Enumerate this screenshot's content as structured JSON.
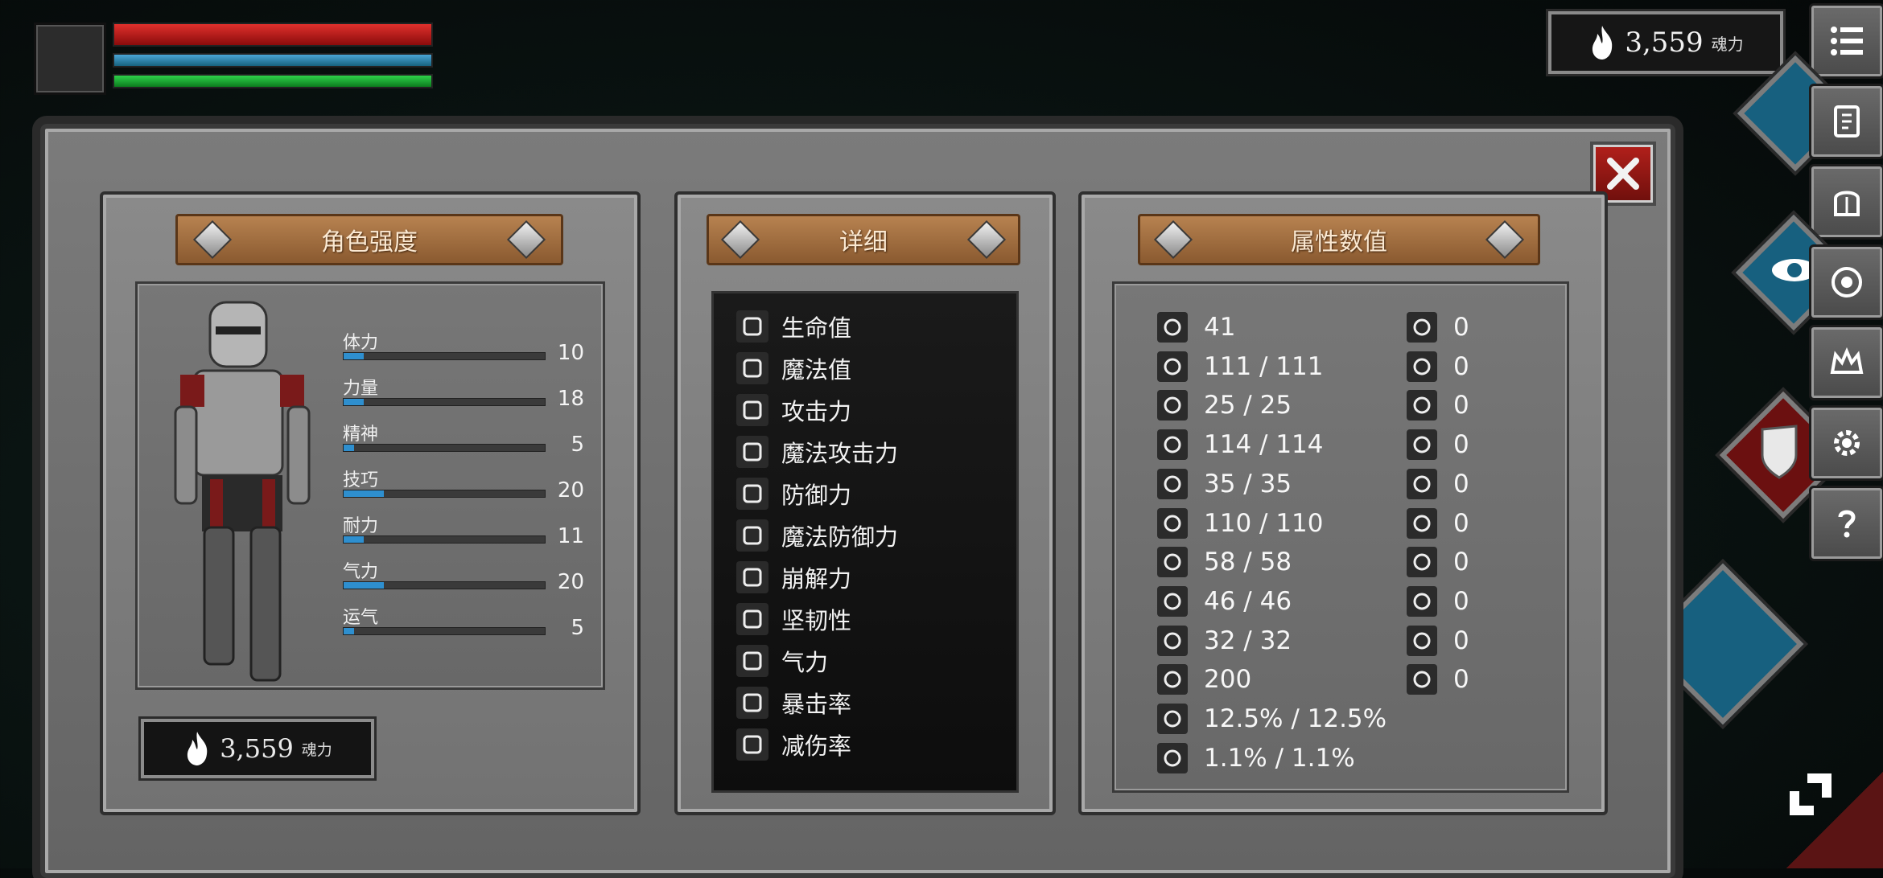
{
  "hud": {
    "hp_pct": 100,
    "mp_pct": 100,
    "stamina_pct": 100
  },
  "souls": {
    "value": "3,559",
    "unit": "魂力"
  },
  "side_menu": [
    "menu-icon",
    "journal-icon",
    "helmet-icon",
    "rune-icon",
    "crown-icon",
    "gear-icon",
    "help-icon"
  ],
  "strength_panel": {
    "title": "角色强度",
    "stats": [
      {
        "label": "体力",
        "value": "10",
        "fill": 0.1
      },
      {
        "label": "力量",
        "value": "18",
        "fill": 0.1
      },
      {
        "label": "精神",
        "value": "5",
        "fill": 0.05
      },
      {
        "label": "技巧",
        "value": "20",
        "fill": 0.2
      },
      {
        "label": "耐力",
        "value": "11",
        "fill": 0.1
      },
      {
        "label": "气力",
        "value": "20",
        "fill": 0.2
      },
      {
        "label": "运气",
        "value": "5",
        "fill": 0.05
      }
    ]
  },
  "details_panel": {
    "title": "详细",
    "items": [
      "生命值",
      "魔法值",
      "攻击力",
      "魔法攻击力",
      "防御力",
      "魔法防御力",
      "崩解力",
      "坚韧性",
      "气力",
      "暴击率",
      "减伤率"
    ]
  },
  "attributes_panel": {
    "title": "属性数值",
    "left_values": [
      "41",
      "111 / 111",
      "25 / 25",
      "114 / 114",
      "35 / 35",
      "110 / 110",
      "58 / 58",
      "46 / 46",
      "32 / 32",
      "200",
      "12.5% / 12.5%",
      "1.1% / 1.1%"
    ],
    "right_values": [
      "0",
      "0",
      "0",
      "0",
      "0",
      "0",
      "0",
      "0",
      "0",
      "0"
    ]
  }
}
